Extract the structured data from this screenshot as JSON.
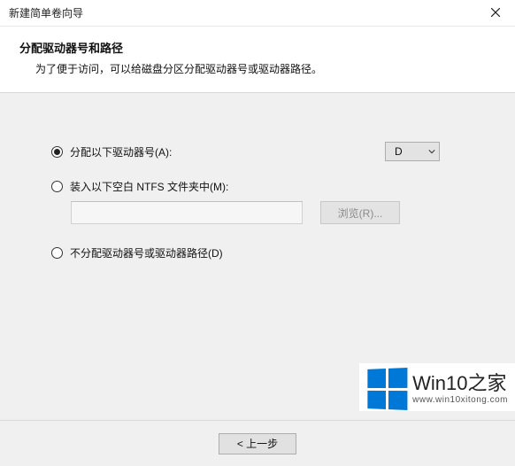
{
  "window": {
    "title": "新建简单卷向导"
  },
  "header": {
    "title": "分配驱动器号和路径",
    "subtitle": "为了便于访问，可以给磁盘分区分配驱动器号或驱动器路径。"
  },
  "options": {
    "assign_letter": {
      "label": "分配以下驱动器号(A):",
      "value": "D"
    },
    "mount_folder": {
      "label": "装入以下空白 NTFS 文件夹中(M):",
      "path": "",
      "browse": "浏览(R)..."
    },
    "no_assign": {
      "label": "不分配驱动器号或驱动器路径(D)"
    }
  },
  "footer": {
    "back": "< 上一步"
  },
  "watermark": {
    "main": "Win10之家",
    "sub": "www.win10xitong.com"
  }
}
